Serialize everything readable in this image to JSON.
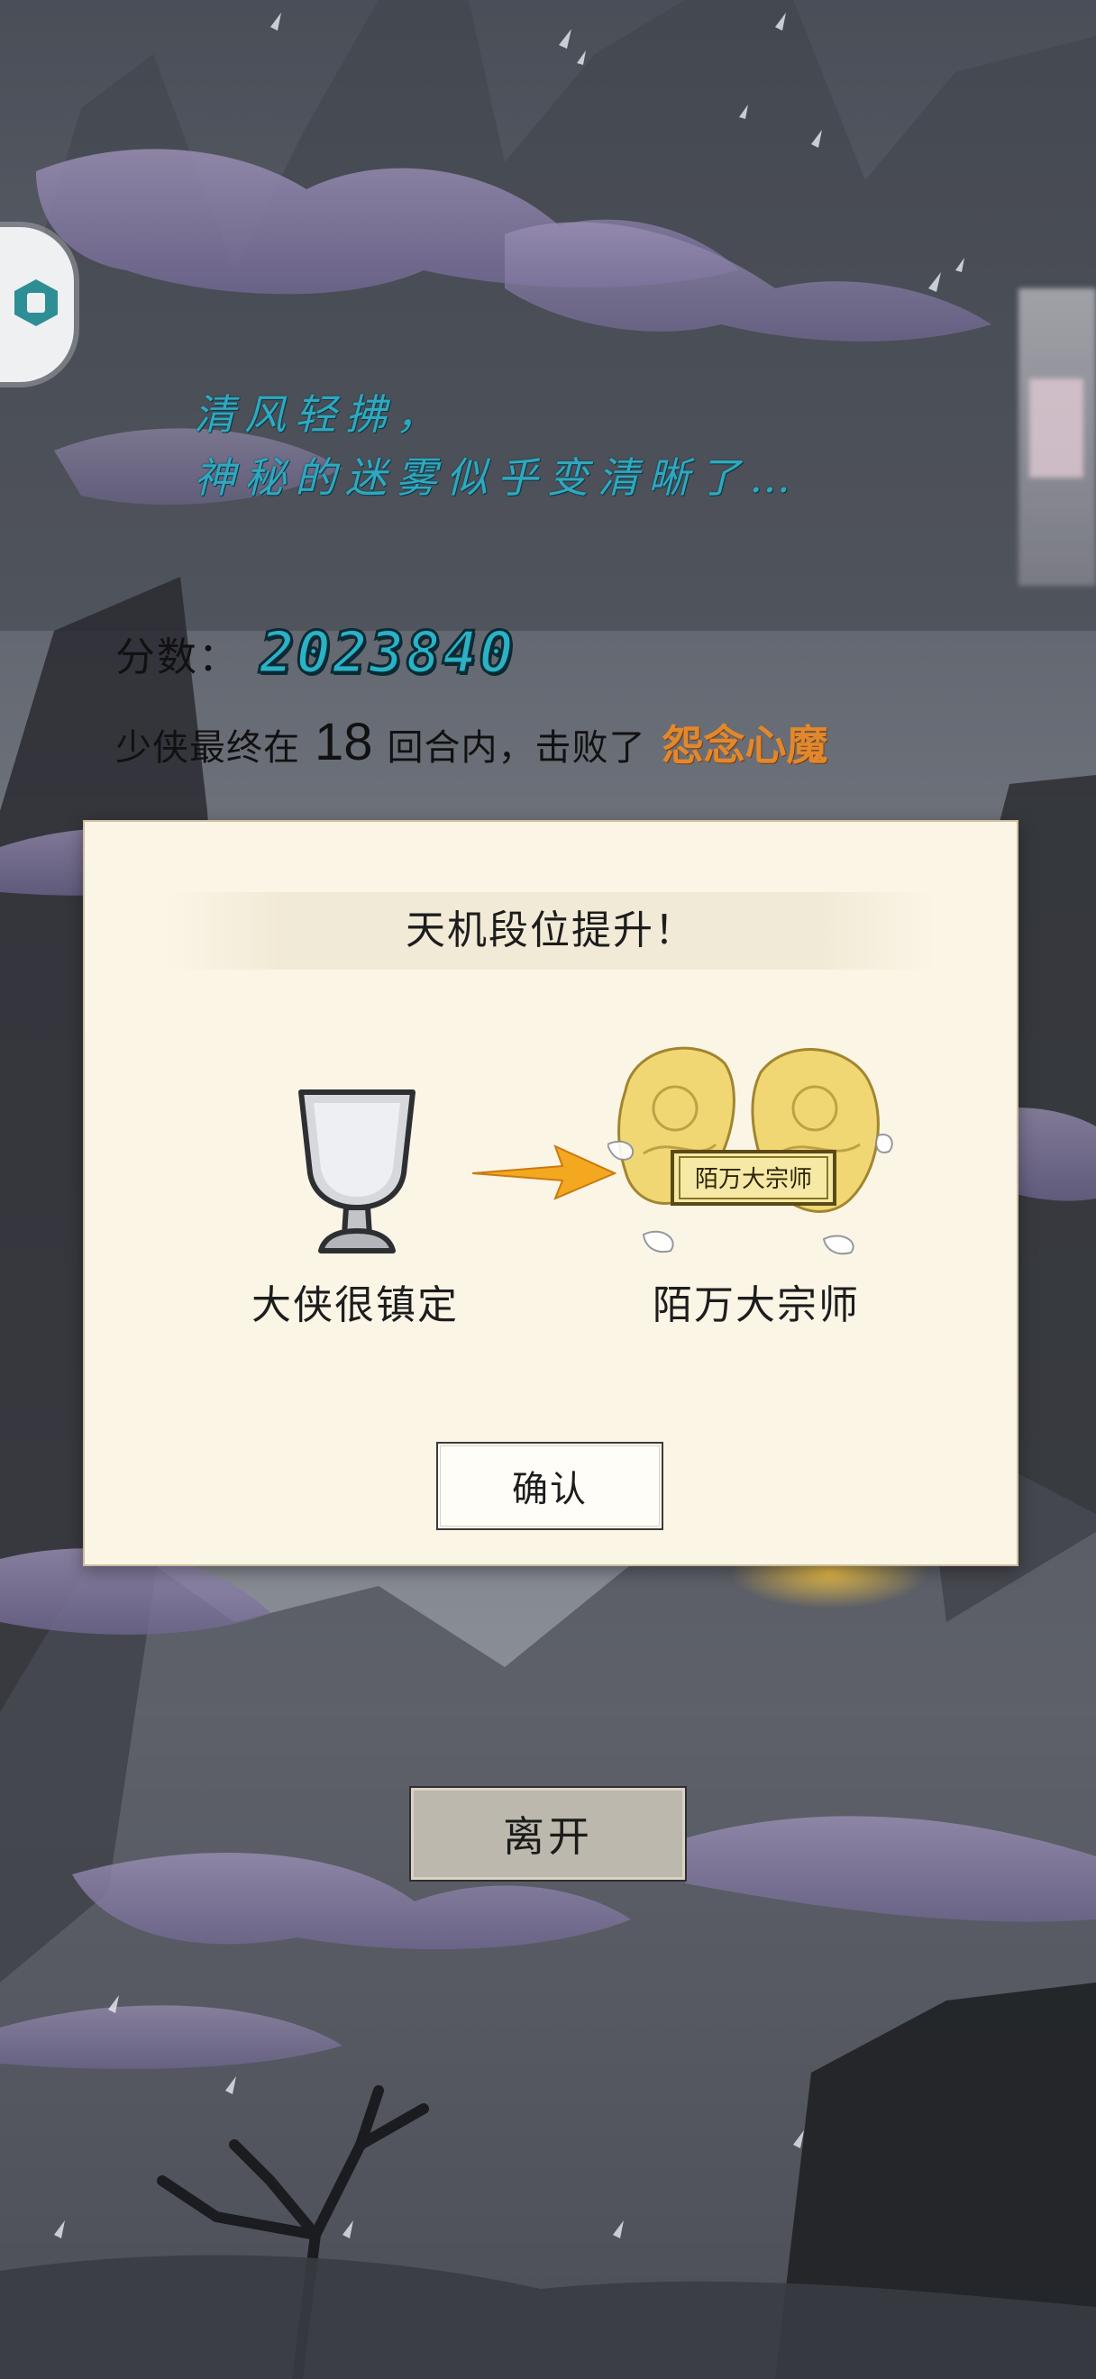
{
  "poem": {
    "line1": "清风轻拂，",
    "line2": "神秘的迷雾似乎变清晰了…"
  },
  "result": {
    "score_label": "分数：",
    "score_value": "2023840",
    "defeat_prefix": "少侠最终在",
    "rounds": "18",
    "defeat_middle": "回合内，击败了",
    "boss_name": "怨念心魔"
  },
  "modal": {
    "title": "天机段位提升！",
    "old_rank": "大侠很镇定",
    "new_rank": "陌万大宗师",
    "badge_text": "陌万大宗师",
    "confirm_label": "确认"
  },
  "leave_label": "离开",
  "colors": {
    "poem": "#2fa8bf",
    "score": "#2ab2c6",
    "boss": "#e1882d",
    "modal_bg": "#fbf5e6",
    "arrow": "#f3a81f"
  },
  "icons": {
    "cup": "silver-goblet-icon",
    "arrow": "arrow-right-icon",
    "badge": "golden-dragon-badge-icon",
    "side": "app-logo-icon"
  }
}
